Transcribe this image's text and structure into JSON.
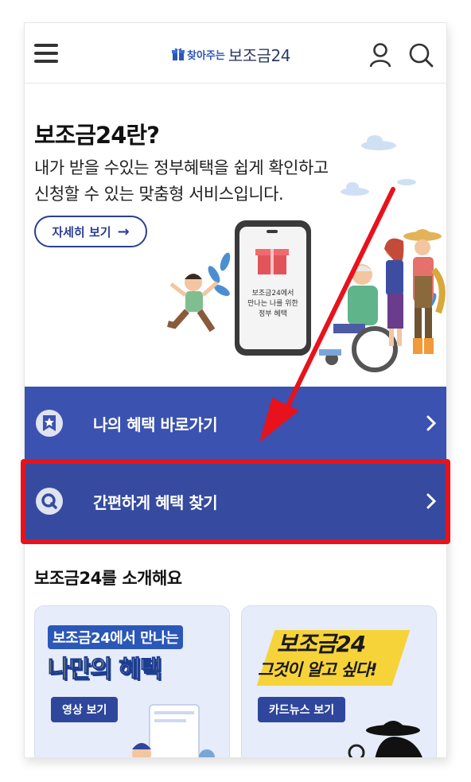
{
  "header": {
    "logo_small": "찾아주는",
    "logo_big": "보조금24",
    "menu_icon": "hamburger-menu-icon",
    "user_icon": "user-icon",
    "search_icon": "search-icon"
  },
  "intro": {
    "title": "보조금24란?",
    "desc_line1": "내가 받을 수있는 정부혜택을 쉽게 확인하고",
    "desc_line2": "신청할 수 있는 맞춤형 서비스입니다.",
    "detail_button": "자세히 보기",
    "phone_text": [
      "보조금24에서",
      "만나는 나를 위한",
      "정부 혜택"
    ]
  },
  "quick_links": [
    {
      "label": "나의 혜택 바로가기",
      "icon": "star-badge-icon"
    },
    {
      "label": "간편하게 혜택 찾기",
      "icon": "search-circle-icon"
    }
  ],
  "section": {
    "title": "보조금24를 소개해요",
    "cards": [
      {
        "banner_top": "보조금24에서 만나는",
        "banner_main_1": "나만의",
        "banner_main_2": "혜택",
        "button": "영상 보기"
      },
      {
        "banner_top": "보조금24",
        "banner_sub": "그것이 알고 싶다!",
        "button": "카드뉴스 보기"
      }
    ]
  },
  "colors": {
    "primary": "#3b52b0",
    "primary_dark": "#364b9f",
    "highlight": "#e8121c",
    "annotation_arrow": "#e8121c"
  }
}
